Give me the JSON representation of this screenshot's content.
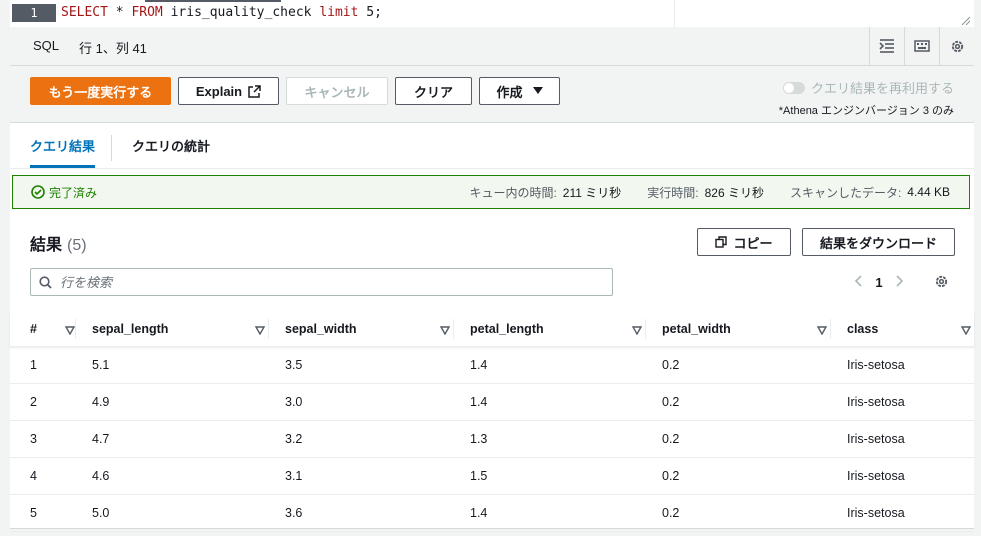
{
  "editor": {
    "line_number": "1",
    "code_parts": [
      {
        "text": "SELECT",
        "kw": true
      },
      {
        "text": " * ",
        "kw": false
      },
      {
        "text": "FROM",
        "kw": true
      },
      {
        "text": " iris_quality_check ",
        "kw": false
      },
      {
        "text": "limit",
        "kw": true
      },
      {
        "text": " 5;",
        "kw": false
      }
    ]
  },
  "statusbar": {
    "language": "SQL",
    "cursor_position": "行 1、列 41",
    "icons": [
      "format-icon",
      "keyboard-icon",
      "settings-icon"
    ]
  },
  "toolbar": {
    "run_again": "もう一度実行する",
    "explain": "Explain",
    "cancel": "キャンセル",
    "clear": "クリア",
    "create": "作成",
    "reuse_label": "クエリ結果を再利用する",
    "engine_note": "*Athena エンジンバージョン 3 のみ"
  },
  "tabs": [
    {
      "label": "クエリ結果",
      "active": true
    },
    {
      "label": "クエリの統計",
      "active": false
    }
  ],
  "status": {
    "state": "完了済み",
    "queue_label": "キュー内の時間:",
    "queue_value": "211 ミリ秒",
    "run_label": "実行時間:",
    "run_value": "826 ミリ秒",
    "scan_label": "スキャンしたデータ:",
    "scan_value": "4.44 KB"
  },
  "results": {
    "title": "結果",
    "count": "(5)",
    "copy": "コピー",
    "download": "結果をダウンロード",
    "search_placeholder": "行を検索",
    "page": "1"
  },
  "table": {
    "columns": [
      "#",
      "sepal_length",
      "sepal_width",
      "petal_length",
      "petal_width",
      "class"
    ],
    "rows": [
      [
        "1",
        "5.1",
        "3.5",
        "1.4",
        "0.2",
        "Iris-setosa"
      ],
      [
        "2",
        "4.9",
        "3.0",
        "1.4",
        "0.2",
        "Iris-setosa"
      ],
      [
        "3",
        "4.7",
        "3.2",
        "1.3",
        "0.2",
        "Iris-setosa"
      ],
      [
        "4",
        "4.6",
        "3.1",
        "1.5",
        "0.2",
        "Iris-setosa"
      ],
      [
        "5",
        "5.0",
        "3.6",
        "1.4",
        "0.2",
        "Iris-setosa"
      ]
    ]
  },
  "colors": {
    "primary": "#ec7211",
    "link": "#0073bb",
    "success": "#1d8102"
  }
}
